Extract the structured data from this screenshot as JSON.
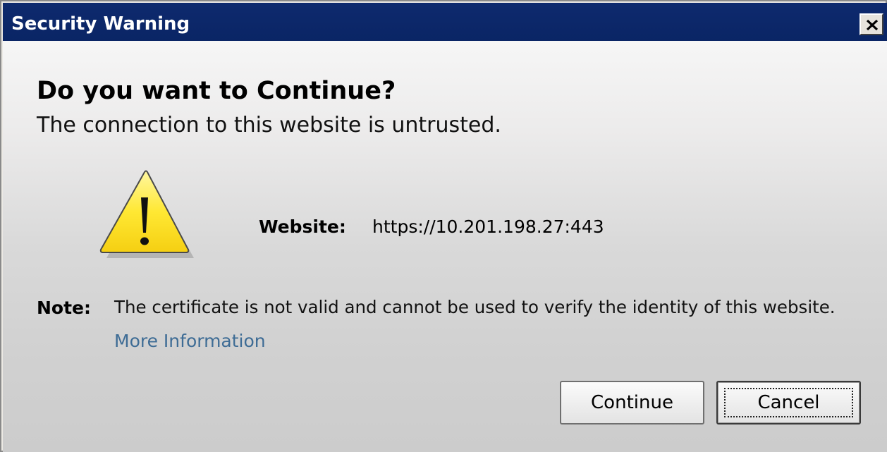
{
  "window": {
    "title": "Security Warning",
    "close_icon": "close-icon"
  },
  "dialog": {
    "heading": "Do you want to Continue?",
    "subheading": "The connection to this website is untrusted.",
    "icon": "warning-icon",
    "website_label": "Website:",
    "website_url": "https://10.201.198.27:443",
    "note_label": "Note:",
    "note_text": "The certificate is not valid and cannot be used to verify the identity of this website.",
    "more_info_link": "More Information"
  },
  "buttons": {
    "continue_label": "Continue",
    "cancel_label": "Cancel",
    "focused": "Cancel"
  },
  "colors": {
    "titlebar": "#0a2565",
    "link": "#3e6c95",
    "warning_fill": "#ffe833"
  }
}
